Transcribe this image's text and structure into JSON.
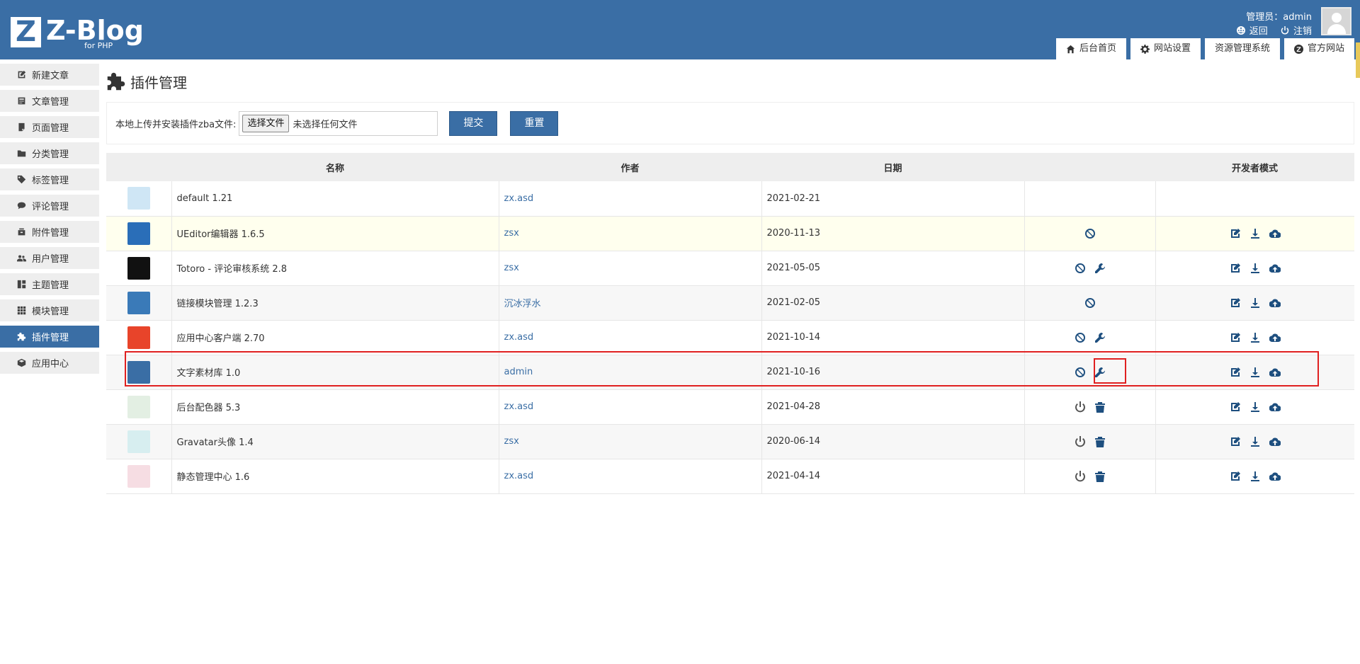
{
  "brand": {
    "logo_letter": "Z",
    "name": "Z-Blog",
    "sub": "for PHP"
  },
  "user": {
    "role_label": "管理员：admin",
    "back": "返回",
    "logout": "注销"
  },
  "top_tabs": [
    {
      "label": "后台首页",
      "icon": "home-icon"
    },
    {
      "label": "网站设置",
      "icon": "gear-icon"
    },
    {
      "label": "资源管理系统",
      "icon": ""
    },
    {
      "label": "官方网站",
      "icon": "zblog-icon"
    }
  ],
  "sidebar": {
    "items": [
      {
        "label": "新建文章",
        "icon": "edit-icon"
      },
      {
        "label": "文章管理",
        "icon": "article-icon"
      },
      {
        "label": "页面管理",
        "icon": "page-icon"
      },
      {
        "label": "分类管理",
        "icon": "folder-icon"
      },
      {
        "label": "标签管理",
        "icon": "tag-icon"
      },
      {
        "label": "评论管理",
        "icon": "comment-icon"
      },
      {
        "label": "附件管理",
        "icon": "attachment-icon"
      },
      {
        "label": "用户管理",
        "icon": "users-icon"
      },
      {
        "label": "主题管理",
        "icon": "theme-icon"
      },
      {
        "label": "模块管理",
        "icon": "module-icon"
      },
      {
        "label": "插件管理",
        "icon": "plugin-icon",
        "active": true
      },
      {
        "label": "应用中心",
        "icon": "app-center-icon"
      }
    ]
  },
  "page": {
    "title": "插件管理"
  },
  "upload": {
    "label": "本地上传并安装插件zba文件:",
    "choose_file": "选择文件",
    "no_file": "未选择任何文件",
    "submit": "提交",
    "reset": "重置"
  },
  "table": {
    "headers": [
      "",
      "名称",
      "作者",
      "日期",
      "",
      "开发者模式"
    ],
    "rows": [
      {
        "name": "default 1.21",
        "author": "zx.asd",
        "date": "2021-02-21",
        "icon_color": "#cfe6f5",
        "actions": [],
        "dev": false
      },
      {
        "name": "UEditor编辑器 1.6.5",
        "author": "zsx",
        "date": "2020-11-13",
        "icon_color": "#2a6eb8",
        "actions": [
          "disable"
        ],
        "dev": true
      },
      {
        "name": "Totoro - 评论审核系统 2.8",
        "author": "zsx",
        "date": "2021-05-05",
        "icon_color": "#111111",
        "actions": [
          "disable",
          "settings"
        ],
        "dev": true
      },
      {
        "name": "链接模块管理 1.2.3",
        "author": "沉冰浮水",
        "date": "2021-02-05",
        "icon_color": "#3a7ab8",
        "actions": [
          "disable"
        ],
        "dev": true
      },
      {
        "name": "应用中心客户端 2.70",
        "author": "zx.asd",
        "date": "2021-10-14",
        "icon_color": "#e8442a",
        "actions": [
          "disable",
          "settings"
        ],
        "dev": true
      },
      {
        "name": "文字素材库 1.0",
        "author": "admin",
        "date": "2021-10-16",
        "icon_color": "#3a6ea5",
        "actions": [
          "disable",
          "settings"
        ],
        "dev": true
      },
      {
        "name": "后台配色器 5.3",
        "author": "zx.asd",
        "date": "2021-04-28",
        "icon_color": "#e3efe3",
        "actions": [
          "enable",
          "delete"
        ],
        "dev": true
      },
      {
        "name": "Gravatar头像 1.4",
        "author": "zsx",
        "date": "2020-06-14",
        "icon_color": "#d7eef0",
        "actions": [
          "enable",
          "delete"
        ],
        "dev": true
      },
      {
        "name": "静态管理中心 1.6",
        "author": "zx.asd",
        "date": "2021-04-14",
        "icon_color": "#f6dde3",
        "actions": [
          "enable",
          "delete"
        ],
        "dev": true
      }
    ]
  },
  "colors": {
    "header": "#3a6ea5",
    "highlight_border": "#e02020"
  }
}
